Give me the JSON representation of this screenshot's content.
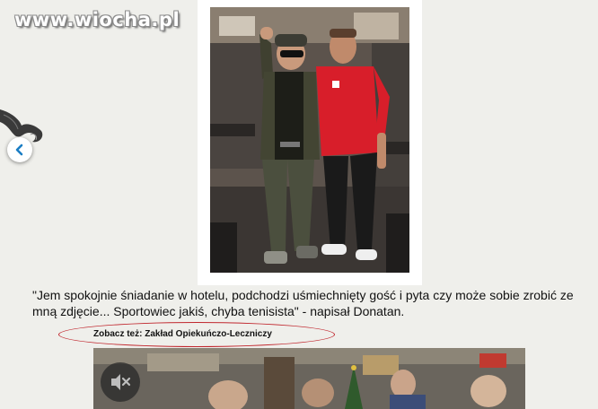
{
  "site": {
    "watermark": "www.wiocha.pl"
  },
  "navigation": {
    "prev_icon": "chevron-left-icon"
  },
  "article": {
    "quote": "\"Jem spokojnie śniadanie w hotelu, podchodzi uśmiechnięty gość i pyta czy może sobie zrobić ze mną zdjęcie... Sportowiec jakiś, chyba tenisista\" - napisał Donatan."
  },
  "see_also": {
    "text": "Zobacz też: Zakład Opiekuńczo-Leczniczy"
  },
  "video": {
    "mute_icon": "speaker-muted-icon"
  },
  "colors": {
    "background": "#efefeb",
    "oval": "#c0262d",
    "shirt_red": "#d81e2a"
  }
}
